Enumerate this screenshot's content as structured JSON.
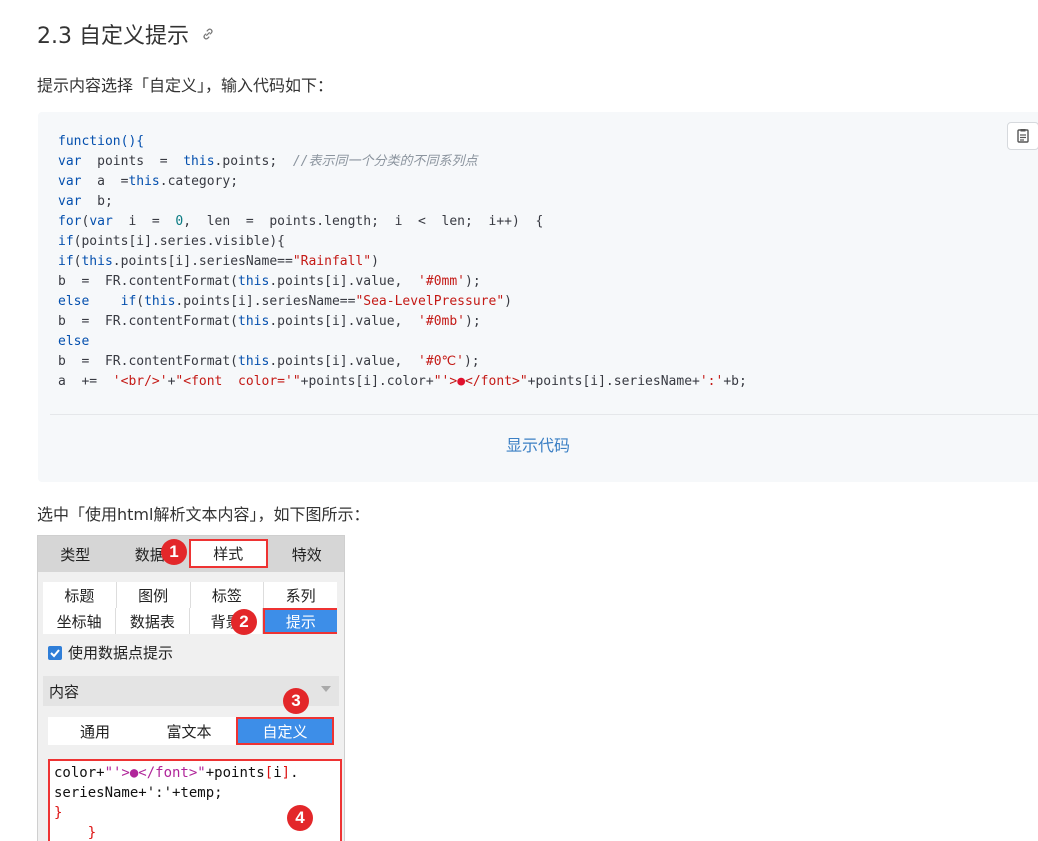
{
  "heading": {
    "title": "2.3 自定义提示"
  },
  "intro_text": "提示内容选择「自定义」，输入代码如下：",
  "code_lines": [
    "function(){",
    "var  points  =  this.points;  //表示同一个分类的不同系列点",
    "var  a  =this.category;",
    "var  b;",
    "for(var  i  =  0,  len  =  points.length;  i  <  len;  i++)  {",
    "if(points[i].series.visible){",
    "if(this.points[i].seriesName==\"Rainfall\")",
    "b  =  FR.contentFormat(this.points[i].value,  '#0mm');",
    "else    if(this.points[i].seriesName==\"Sea-LevelPressure\")",
    "b  =  FR.contentFormat(this.points[i].value,  '#0mb');",
    "else",
    "b  =  FR.contentFormat(this.points[i].value,  '#0℃');",
    "a  +=  '<br/>'+\"<font  color='\"+points[i].color+\"'>●</font>\"+points[i].seriesName+':'+b;"
  ],
  "show_code_label": "显示代码",
  "intro2_text": "选中「使用html解析文本内容」，如下图所示：",
  "panel": {
    "tabs": [
      "类型",
      "数据",
      "样式",
      "特效"
    ],
    "grid_row1": [
      "标题",
      "图例",
      "标签",
      "系列"
    ],
    "grid_row2": [
      "坐标轴",
      "数据表",
      "背景",
      "提示"
    ],
    "checkbox_label": "使用数据点提示",
    "section_label": "内容",
    "segments": [
      "通用",
      "富文本",
      "自定义"
    ],
    "editor_lines": [
      "color+\"'>●</font>\"+points[i].",
      "seriesName+':'+temp;",
      "}",
      "    }"
    ],
    "badges": [
      "1",
      "2",
      "3",
      "4"
    ]
  }
}
